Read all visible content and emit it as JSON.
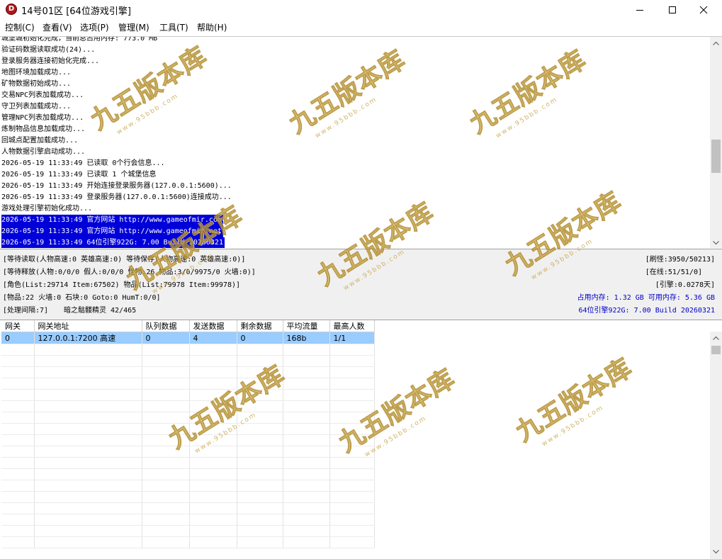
{
  "window": {
    "title": "14号01区 [64位游戏引擎]",
    "icon_letter": "D"
  },
  "menu": [
    {
      "label": "控制(C)"
    },
    {
      "label": "查看(V)"
    },
    {
      "label": "选项(P)"
    },
    {
      "label": "管理(M)"
    },
    {
      "label": "工具(T)"
    },
    {
      "label": "帮助(H)"
    }
  ],
  "log": {
    "lines": [
      {
        "text": "城堡城初始化完成，当前总占用内存: 773.0 MB",
        "selected": false
      },
      {
        "text": "验证码数据读取成功(24)...",
        "selected": false
      },
      {
        "text": "登录服务器连接初始化完成...",
        "selected": false
      },
      {
        "text": "地图环境加载成功...",
        "selected": false
      },
      {
        "text": "矿物数据初始成功...",
        "selected": false
      },
      {
        "text": "交易NPC列表加载成功...",
        "selected": false
      },
      {
        "text": "守卫列表加载成功...",
        "selected": false
      },
      {
        "text": "管理NPC列表加载成功...",
        "selected": false
      },
      {
        "text": "炼制物品信息加载成功...",
        "selected": false
      },
      {
        "text": "回城点配置加载成功...",
        "selected": false
      },
      {
        "text": "人物数据引擎启动成功...",
        "selected": false
      },
      {
        "text": "2026-05-19 11:33:49 已读取 0个行会信息...",
        "selected": false
      },
      {
        "text": "2026-05-19 11:33:49 已读取 1 个城堡信息",
        "selected": false
      },
      {
        "text": "2026-05-19 11:33:49 开始连接登录服务器(127.0.0.1:5600)...",
        "selected": false
      },
      {
        "text": "2026-05-19 11:33:49 登录服务器(127.0.0.1:5600)连接成功...",
        "selected": false
      },
      {
        "text": "游戏处理引擎初始化成功...",
        "selected": false
      },
      {
        "text": "2026-05-19 11:33:49 官方网站 http://www.gameofmir.com",
        "selected": true
      },
      {
        "text": "2026-05-19 11:33:49 官方网站 http://www.gameofmir.net",
        "selected": true
      },
      {
        "text": "2026-05-19 11:33:49 64位引擎922G: 7.00 Build 20260321",
        "selected": true
      }
    ]
  },
  "status": {
    "left": [
      "[等待读取(人物高速:0 英雄高速:0) 等待保存(人物高速:0 英雄高速:0)]",
      "[等待释放(人物:0/0/0 假人:0/0/0 怪物:26 物品:3/0/9975/0 火墙:0)]",
      "[角色(List:29714 Item:67502) 物品(List:79978 Item:99978)]",
      "[物品:22 火墙:0 石块:0 Goto:0 HumT:0/0]",
      "[处理间隔:7]",
      "暗之骷髅精灵 42/465"
    ],
    "right": [
      "[刷怪:3950/50213]",
      "[在线:51/51/0]",
      "[引擎:0.0278天]",
      "占用内存: 1.32 GB 可用内存: 5.36 GB",
      "64位引擎922G: 7.00 Build 20260321"
    ],
    "colors": {
      "normal": "#000000",
      "info": "#0000c8"
    }
  },
  "grid": {
    "headers": [
      "网关",
      "网关地址",
      "队列数据",
      "发送数据",
      "剩余数据",
      "平均流量",
      "最高人数"
    ],
    "rows": [
      [
        "0",
        "127.0.0.1:7200 高速",
        "0",
        "4",
        "0",
        "168b",
        "1/1"
      ]
    ]
  },
  "watermark": {
    "text": "九五版本库",
    "url": "www.95bbb.com"
  },
  "colors": {
    "selection": "#0000d8",
    "row_selection": "#99ccff",
    "status_bg": "#f0f0f0",
    "watermark_gold": "#e8c96a"
  }
}
